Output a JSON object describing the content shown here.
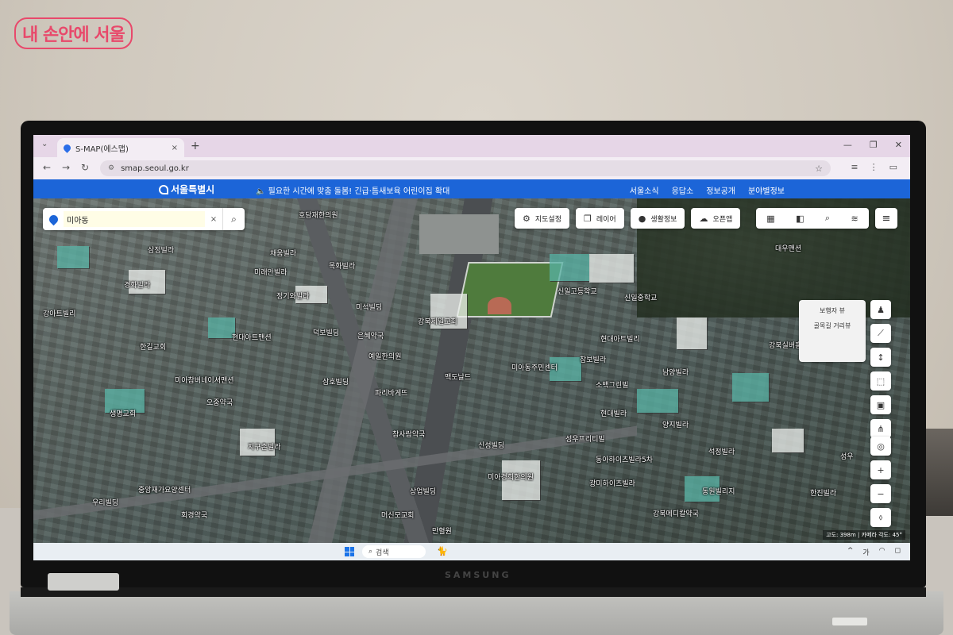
{
  "watermark": {
    "text": "내 손안에 서울"
  },
  "device": {
    "brand": "SAMSUNG"
  },
  "browser": {
    "tab_title": "S-MAP(에스맵)",
    "tab_close": "×",
    "new_tab": "+",
    "url": "smap.seoul.go.kr",
    "back_icon": "arrow-left",
    "forward_icon": "arrow-right",
    "reload_icon": "reload"
  },
  "site": {
    "logo_text": "서울특별시",
    "notice": "🔈 필요한 시간에 맞춤 돌봄! 긴급·틈새보육 어린이집 확대",
    "nav": [
      "서울소식",
      "응답소",
      "정보공개",
      "분야별정보"
    ]
  },
  "search": {
    "value": "미아동",
    "clear": "×",
    "button_icon": "search-icon"
  },
  "toolbar": {
    "settings_label": "지도설정",
    "layer_label": "레이어",
    "life_info_label": "생활정보",
    "open_app_label": "오픈앱"
  },
  "view_panel": {
    "pedestrian_view": "보행자 뷰",
    "alley_street_view": "골목길 거리뷰"
  },
  "zoom": {
    "in": "+",
    "out": "−"
  },
  "scale_text": "고도: 398m | 카메라 각도: 45°",
  "taskbar": {
    "search_label": "검색"
  },
  "tray": {
    "lang": "가"
  },
  "map_labels": [
    "호담재한의원",
    "삼정빌라",
    "채움빌라",
    "미래안빌라",
    "목화빌라",
    "경화빌라",
    "정기와빌라",
    "미석빌딩",
    "강아트빌리",
    "덕보빌딩",
    "은혜약국",
    "현대아트맨션",
    "한길교회",
    "예일한의원",
    "미아참버네이셔맨션",
    "삼호빌딩",
    "파리바게뜨",
    "생명교회",
    "오중약국",
    "지구촌빌라",
    "중앙재가요양센터",
    "우리빌딩",
    "회경약국",
    "상업빌딩",
    "머신모교회",
    "만혈원",
    "참사람약국",
    "강북제일교회",
    "신일고등학교",
    "신일중학교",
    "현대아트빌리",
    "대우맨션",
    "맥도날드",
    "미아동주민센터",
    "참보빌라",
    "남양빌라",
    "소백그린빌",
    "현대빌라",
    "양지빌라",
    "신성빌딩",
    "성우프리티빌",
    "동아하이츠빌라5차",
    "석정빌라",
    "미아경희한의원",
    "광미하이츠빌라",
    "동원빌리지",
    "강북메디칼약국",
    "한진빌라",
    "강북실버홈",
    "성우"
  ]
}
